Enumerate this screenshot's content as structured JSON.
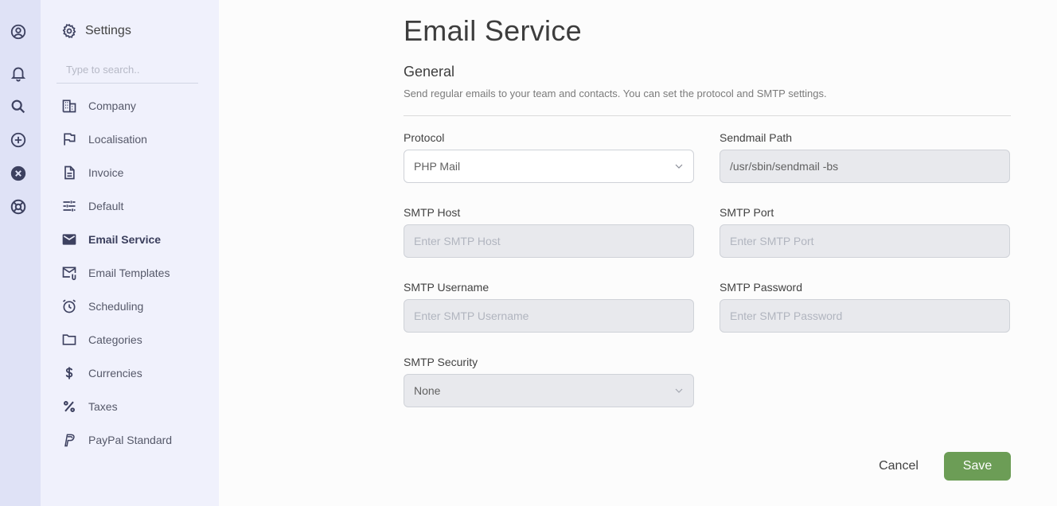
{
  "sidebar": {
    "title": "Settings",
    "search_placeholder": "Type to search..",
    "items": [
      {
        "label": "Company",
        "icon": "building-icon"
      },
      {
        "label": "Localisation",
        "icon": "flag-icon"
      },
      {
        "label": "Invoice",
        "icon": "document-icon"
      },
      {
        "label": "Default",
        "icon": "sliders-icon"
      },
      {
        "label": "Email Service",
        "icon": "envelope-icon",
        "active": true
      },
      {
        "label": "Email Templates",
        "icon": "email-template-icon"
      },
      {
        "label": "Scheduling",
        "icon": "alarm-clock-icon"
      },
      {
        "label": "Categories",
        "icon": "folder-icon"
      },
      {
        "label": "Currencies",
        "icon": "dollar-icon"
      },
      {
        "label": "Taxes",
        "icon": "percent-icon"
      },
      {
        "label": "PayPal Standard",
        "icon": "paypal-icon"
      }
    ]
  },
  "rail": {
    "icons": [
      "user-circle-icon",
      "bell-icon",
      "search-icon",
      "plus-circle-icon",
      "close-circle-icon",
      "lifebuoy-icon"
    ]
  },
  "main": {
    "title": "Email Service",
    "section_title": "General",
    "section_desc": "Send regular emails to your team and contacts. You can set the protocol and SMTP settings.",
    "fields": {
      "protocol": {
        "label": "Protocol",
        "value": "PHP Mail"
      },
      "sendmail_path": {
        "label": "Sendmail Path",
        "value": "/usr/sbin/sendmail -bs"
      },
      "smtp_host": {
        "label": "SMTP Host",
        "placeholder": "Enter SMTP Host"
      },
      "smtp_port": {
        "label": "SMTP Port",
        "placeholder": "Enter SMTP Port"
      },
      "smtp_username": {
        "label": "SMTP Username",
        "placeholder": "Enter SMTP Username"
      },
      "smtp_password": {
        "label": "SMTP Password",
        "placeholder": "Enter SMTP Password"
      },
      "smtp_security": {
        "label": "SMTP Security",
        "value": "None"
      }
    },
    "cancel_label": "Cancel",
    "save_label": "Save"
  },
  "colors": {
    "rail_bg": "#dfe2f6",
    "sidebar_bg": "#f0f1fc",
    "save_button": "#6c9d56",
    "icon": "#3d4160"
  }
}
